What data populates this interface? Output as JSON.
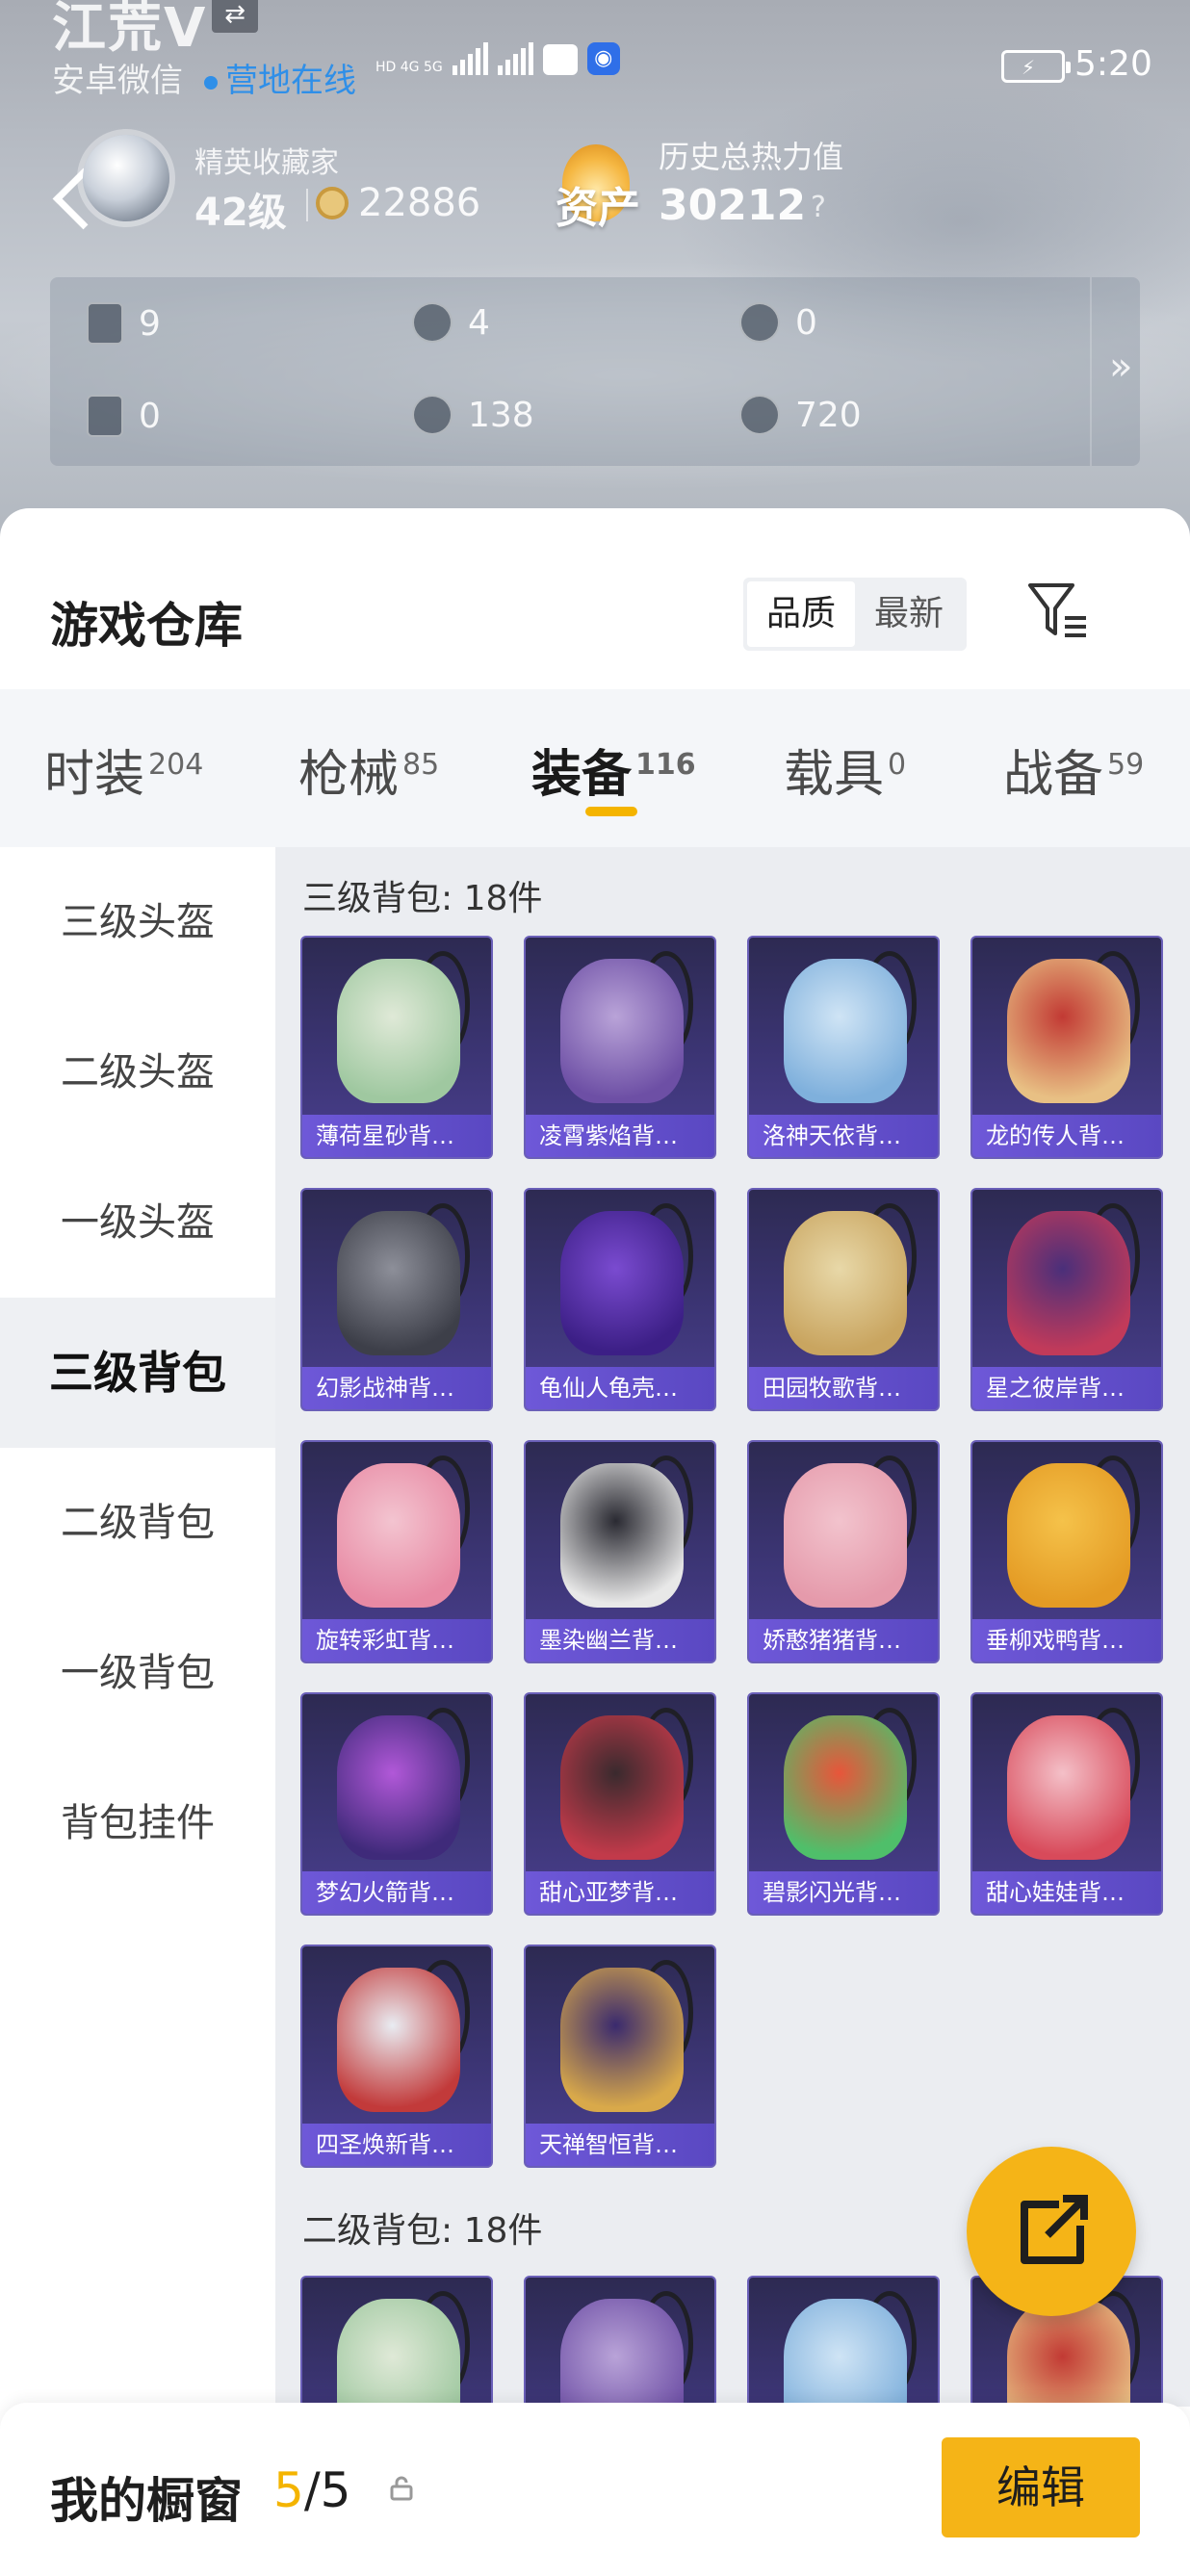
{
  "status": {
    "title": "江荒V",
    "subtitle": "安卓微信",
    "online": "营地在线",
    "network": "HD 4G 5G",
    "time": "5:20"
  },
  "profile": {
    "rank_label": "精英收藏家",
    "level": "42级",
    "coins": "22886",
    "asset_label": "资产",
    "heat_label": "历史总热力值",
    "heat_value": "30212",
    "help_glyph": "?"
  },
  "resources": [
    {
      "icon": "card-icon",
      "value": "9"
    },
    {
      "icon": "medal-icon",
      "value": "4"
    },
    {
      "icon": "crest-icon",
      "value": "0"
    },
    {
      "icon": "ticket-icon",
      "value": "0"
    },
    {
      "icon": "orb-icon",
      "value": "138"
    },
    {
      "icon": "coin-icon",
      "value": "720"
    }
  ],
  "resources_more": "»",
  "warehouse": {
    "title": "游戏仓库",
    "sort": [
      "品质",
      "最新"
    ],
    "tabs": [
      {
        "label": "时装",
        "count": "204"
      },
      {
        "label": "枪械",
        "count": "85"
      },
      {
        "label": "装备",
        "count": "116"
      },
      {
        "label": "载具",
        "count": "0"
      },
      {
        "label": "战备",
        "count": "59"
      }
    ],
    "categories": [
      "三级头盔",
      "二级头盔",
      "一级头盔",
      "三级背包",
      "二级背包",
      "一级背包",
      "背包挂件"
    ],
    "sections": [
      {
        "title": "三级背包: 18件",
        "items": [
          "薄荷星砂背…",
          "凌霄紫焰背…",
          "洛神天依背…",
          "龙的传人背…",
          "幻影战神背…",
          "龟仙人龟壳…",
          "田园牧歌背…",
          "星之彼岸背…",
          "旋转彩虹背…",
          "墨染幽兰背…",
          "娇憨猪猪背…",
          "垂柳戏鸭背…",
          "梦幻火箭背…",
          "甜心亚梦背…",
          "碧影闪光背…",
          "甜心娃娃背…",
          "四圣焕新背…",
          "天禅智恒背…"
        ]
      },
      {
        "title": "二级背包: 18件",
        "items": [
          "",
          "",
          "",
          ""
        ]
      }
    ]
  },
  "showcase": {
    "label": "我的橱窗",
    "current": "5",
    "total": "/5",
    "edit": "编辑"
  },
  "colors": {
    "accent": "#f5b417",
    "online": "#2f8fe8",
    "card_top": "#2d2a52",
    "card_label": "#6e58d8"
  }
}
